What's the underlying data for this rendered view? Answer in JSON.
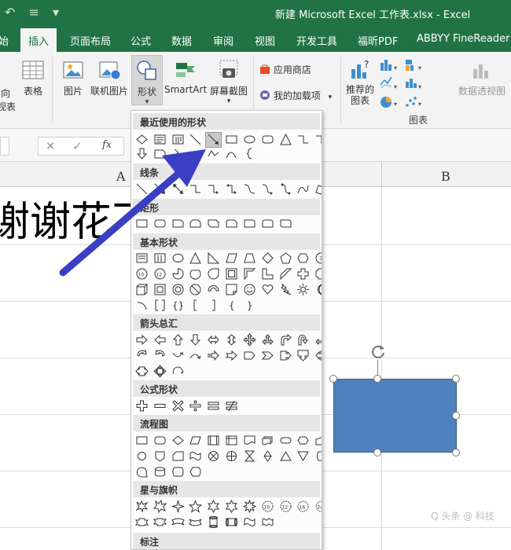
{
  "window": {
    "title": "新建 Microsoft Excel 工作表.xlsx  -  Excel"
  },
  "quick_access": [
    "↶",
    "≡",
    "▾"
  ],
  "tabs": [
    {
      "label": "始"
    },
    {
      "label": "插入",
      "active": true
    },
    {
      "label": "页面布局"
    },
    {
      "label": "公式"
    },
    {
      "label": "数据"
    },
    {
      "label": "审阅"
    },
    {
      "label": "视图"
    },
    {
      "label": "开发工具"
    },
    {
      "label": "福昕PDF"
    },
    {
      "label": "ABBYY FineReader"
    }
  ],
  "ribbon": {
    "left_cut_label_1": "向",
    "left_cut_label_2": "视表",
    "table_label": "表格",
    "picture_label": "图片",
    "online_picture_label": "联机图片",
    "shapes_label": "形状",
    "shapes_caret": "▾",
    "smartart_label": "SmartArt",
    "screenshot_label": "屏幕截图",
    "screenshot_caret": "▾",
    "store_label": "应用商店",
    "addins_label": "我的加载项",
    "addins_caret": "▾",
    "recommended_charts_label_1": "推荐的",
    "recommended_charts_label_2": "图表",
    "pivot_chart_label": "数据透视图",
    "charts_group_label": "图表"
  },
  "formula_bar": {
    "cancel": "✕",
    "enter": "✓",
    "fx": "fx"
  },
  "sheet": {
    "col_a": "A",
    "col_b": "B",
    "cell_text": "谢谢花飞"
  },
  "gallery": {
    "recent": "最近使用的形状",
    "lines": "线条",
    "rectangles": "矩形",
    "basic": "基本形状",
    "block_arrows": "箭头总汇",
    "equation": "公式形状",
    "flowchart": "流程图",
    "stars": "星与旗帜",
    "callouts": "标注"
  },
  "watermark": "Q 头条 @ 科技"
}
